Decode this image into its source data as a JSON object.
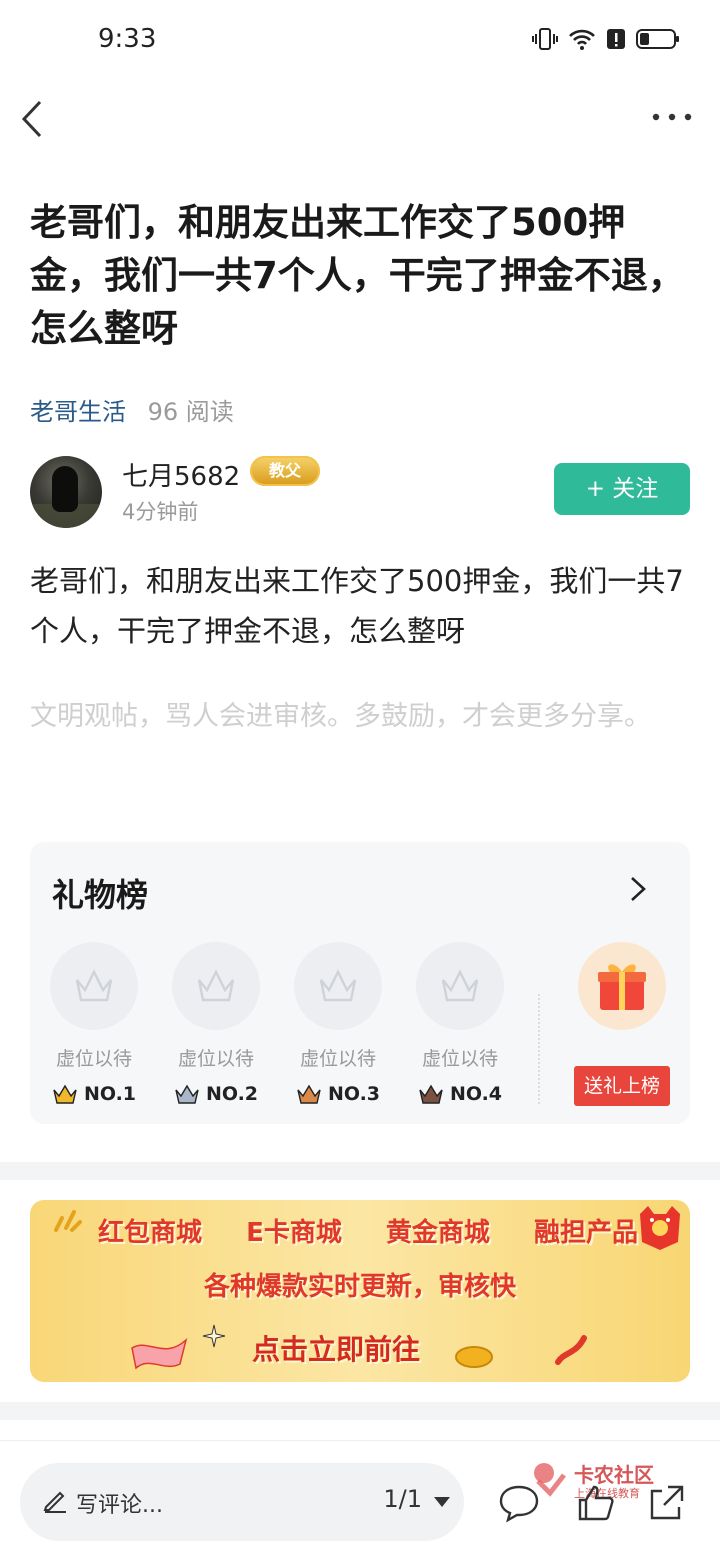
{
  "status_bar": {
    "time": "9:33"
  },
  "post": {
    "title": "老哥们，和朋友出来工作交了500押金，我们一共7个人，干完了押金不退，怎么整呀",
    "category": "老哥生活",
    "reads": "96 阅读",
    "body": "老哥们，和朋友出来工作交了500押金，我们一共7个人，干完了押金不退，怎么整呀",
    "notice": "文明观帖，骂人会进审核。多鼓励，才会更多分享。"
  },
  "author": {
    "name": "七月5682",
    "badge": "教父",
    "time": "4分钟前",
    "follow_label": "+ 关注"
  },
  "gift_board": {
    "title": "礼物榜",
    "slots": [
      {
        "label": "虚位以待",
        "rank": "NO.1",
        "crown_color": "#f0b82a"
      },
      {
        "label": "虚位以待",
        "rank": "NO.2",
        "crown_color": "#a9b7c9"
      },
      {
        "label": "虚位以待",
        "rank": "NO.3",
        "crown_color": "#d98a4b"
      },
      {
        "label": "虚位以待",
        "rank": "NO.4",
        "crown_color": "#7b5142"
      }
    ],
    "send_label": "送礼上榜"
  },
  "banner": {
    "items": [
      "红包商城",
      "E卡商城",
      "黄金商城",
      "融担产品"
    ],
    "subtitle": "各种爆款实时更新，审核快",
    "cta": "点击立即前往"
  },
  "bottom_bar": {
    "comment_placeholder": "写评论...",
    "page": "1/1",
    "watermark_title": "卡农社区",
    "watermark_sub": "上海在线教育"
  },
  "colors": {
    "accent": "#2fba9a",
    "link": "#2b5a8a",
    "red": "#e8453c"
  }
}
